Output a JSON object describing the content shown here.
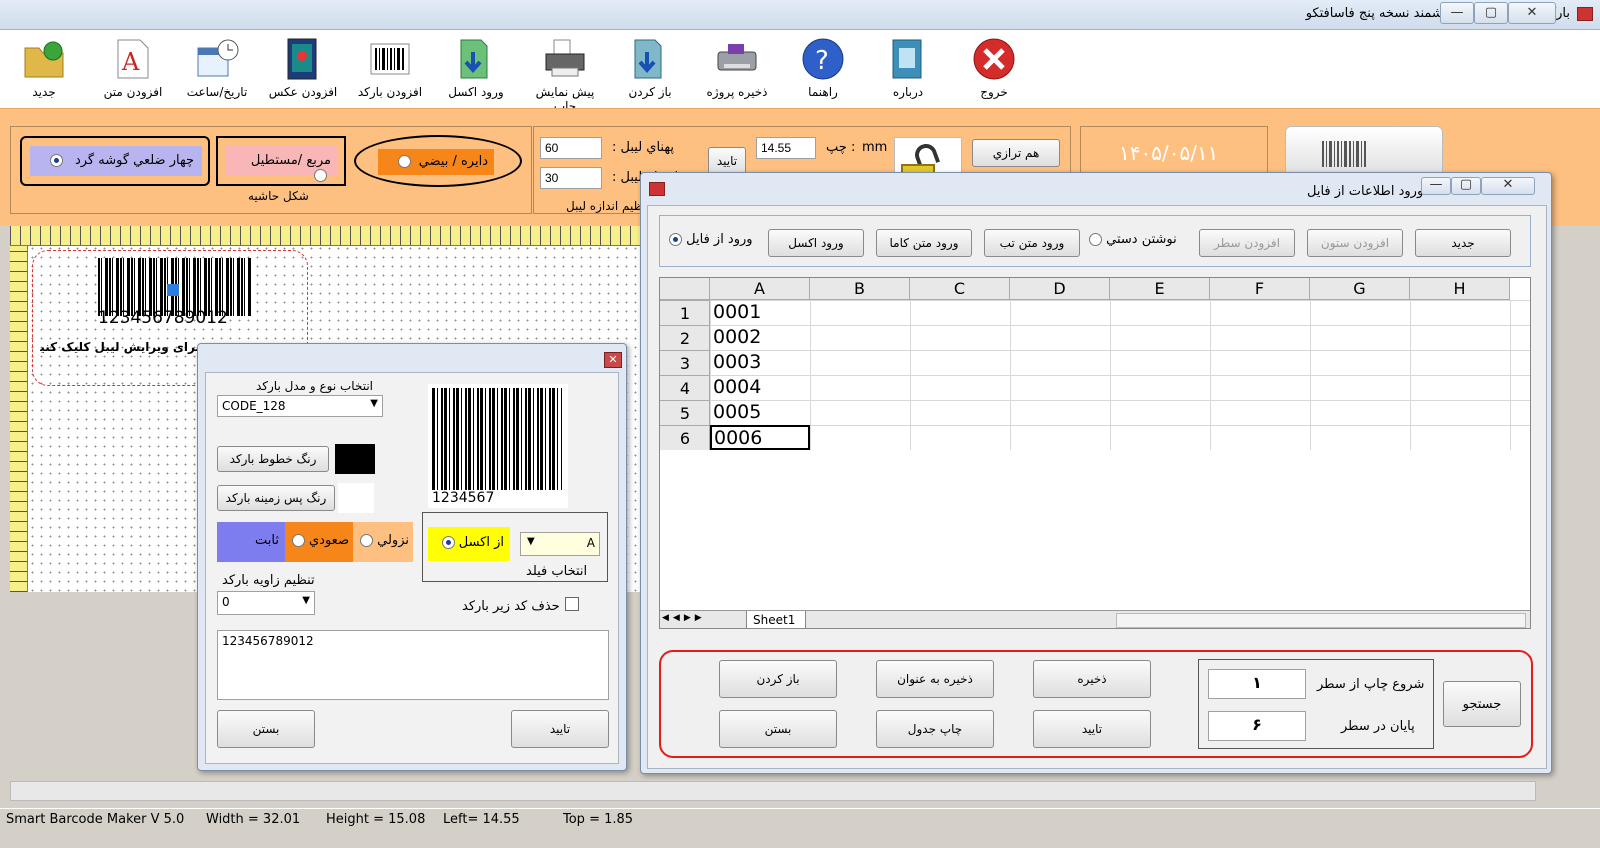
{
  "window": {
    "title": "بارکدساز و لیبل ساز هوشمند نسخه پنج فاسافتکو",
    "min": "—",
    "max": "▢",
    "close": "✕"
  },
  "toolbar": [
    {
      "name": "new",
      "label": "جدید",
      "icon": "folder-icon"
    },
    {
      "name": "add-text",
      "label": "افزودن متن",
      "icon": "text-icon"
    },
    {
      "name": "datetime",
      "label": "تاریخ/ساعت",
      "icon": "calendar-icon"
    },
    {
      "name": "add-image",
      "label": "افزودن عکس",
      "icon": "image-icon"
    },
    {
      "name": "add-barcode",
      "label": "افزودن بارکد",
      "icon": "barcode-icon"
    },
    {
      "name": "import-excel",
      "label": "ورود اکسل",
      "icon": "import-icon"
    },
    {
      "name": "print-preview",
      "label": "پیش نمایش چاپ",
      "icon": "printer-icon"
    },
    {
      "name": "open",
      "label": "باز کردن",
      "icon": "open-icon"
    },
    {
      "name": "save-project",
      "label": "ذخیره پروژه",
      "icon": "save-icon"
    },
    {
      "name": "help",
      "label": "راهنما",
      "icon": "help-icon"
    },
    {
      "name": "about",
      "label": "درباره",
      "icon": "about-icon"
    },
    {
      "name": "exit",
      "label": "خروج",
      "icon": "exit-icon"
    }
  ],
  "shape": {
    "group_label": "شکل حاشیه",
    "round_rect": "چهار ضلعي گوشه گرد",
    "rect": "مربع /مستطیل",
    "ellipse": "دایره / بیضي"
  },
  "size": {
    "width_label": "پهناي لیبل :",
    "width_value": "60",
    "height_label": "ارتفاع لیبل :",
    "height_value": "30",
    "group_label": "تنظیم اندازه لیبل",
    "confirm": "تایید"
  },
  "position": {
    "left_label": "چپ :",
    "unit": "mm",
    "left_value": "14.55",
    "align_btn": "هم ترازي"
  },
  "date": "۱۴۰۵/۰۵/۱۱",
  "canvas": {
    "barcode_text": "123456789012",
    "hint": "برای ویرایش لیبل کلیک کنید!"
  },
  "barcode_dlg": {
    "type_label": "انتخاب نوع و مدل بارکد",
    "type_value": "CODE_128",
    "line_color_btn": "رنگ خطوط بارکد",
    "bg_color_btn": "رنگ پس زمینه بارکد",
    "fixed": "ثابت",
    "asc": "صعودي",
    "desc": "نزولي",
    "angle_label": "تنظیم زاویه بارکد",
    "angle_value": "0",
    "preview_text": "1234567",
    "from_excel": "از اکسل",
    "field_value": "A",
    "field_label": "انتخاب فیلد",
    "hide_code": "حذف کد زیر بارکد",
    "text_value": "123456789012",
    "close": "بستن",
    "ok": "تایید"
  },
  "file_dlg": {
    "title": "ورود اطلاعات از فایل",
    "new": "جدید",
    "add_col": "افزودن ستون",
    "add_row": "افزودن سطر",
    "manual": "نوشتن دستي",
    "tab_input": "ورود متن تب",
    "comma_input": "ورود متن کاما",
    "excel_input": "ورود اکسل",
    "from_file": "ورود از فایل",
    "columns": [
      "A",
      "B",
      "C",
      "D",
      "E",
      "F",
      "G",
      "H"
    ],
    "rows": [
      {
        "n": "1",
        "a": "0001"
      },
      {
        "n": "2",
        "a": "0002"
      },
      {
        "n": "3",
        "a": "0003"
      },
      {
        "n": "4",
        "a": "0004"
      },
      {
        "n": "5",
        "a": "0005"
      },
      {
        "n": "6",
        "a": "0006"
      }
    ],
    "sheet": "Sheet1",
    "open": "باز کردن",
    "save_as": "ذخیره به عنوان",
    "save": "ذخیره",
    "close": "بستن",
    "print_table": "چاپ جدول",
    "ok": "تایید",
    "start_label": "شروع چاپ از سطر",
    "start_value": "۱",
    "end_label": "پایان در سطر",
    "end_value": "۶",
    "search": "جستجو"
  },
  "status": {
    "app": "Smart Barcode Maker V 5.0",
    "width": "Width = 32.01",
    "height": "Height = 15.08",
    "left": "Left= 14.55",
    "top": "Top = 1.85"
  }
}
